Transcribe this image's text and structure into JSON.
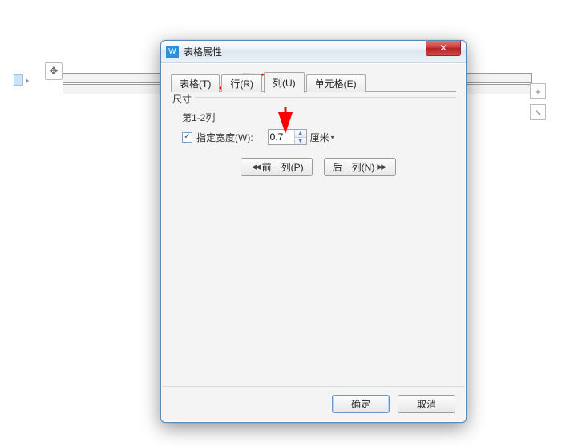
{
  "dialog": {
    "title": "表格属性",
    "icon_letter": "W",
    "close_glyph": "✕"
  },
  "tabs": {
    "table": "表格(T)",
    "row": "行(R)",
    "column": "列(U)",
    "cell": "单元格(E)",
    "active": "column"
  },
  "size": {
    "legend": "尺寸",
    "range": "第1-2列",
    "specify_checked": true,
    "specify_label": "指定宽度(W):",
    "value": "0.7",
    "unit": "厘米"
  },
  "nav": {
    "prev": "前一列(P)",
    "next": "后一列(N)"
  },
  "footer": {
    "ok": "确定",
    "cancel": "取消"
  },
  "bg": {
    "move_glyph": "✥",
    "plus_glyph": "+",
    "diag_glyph": "↘"
  },
  "annotation": {
    "color": "#ff0000"
  }
}
